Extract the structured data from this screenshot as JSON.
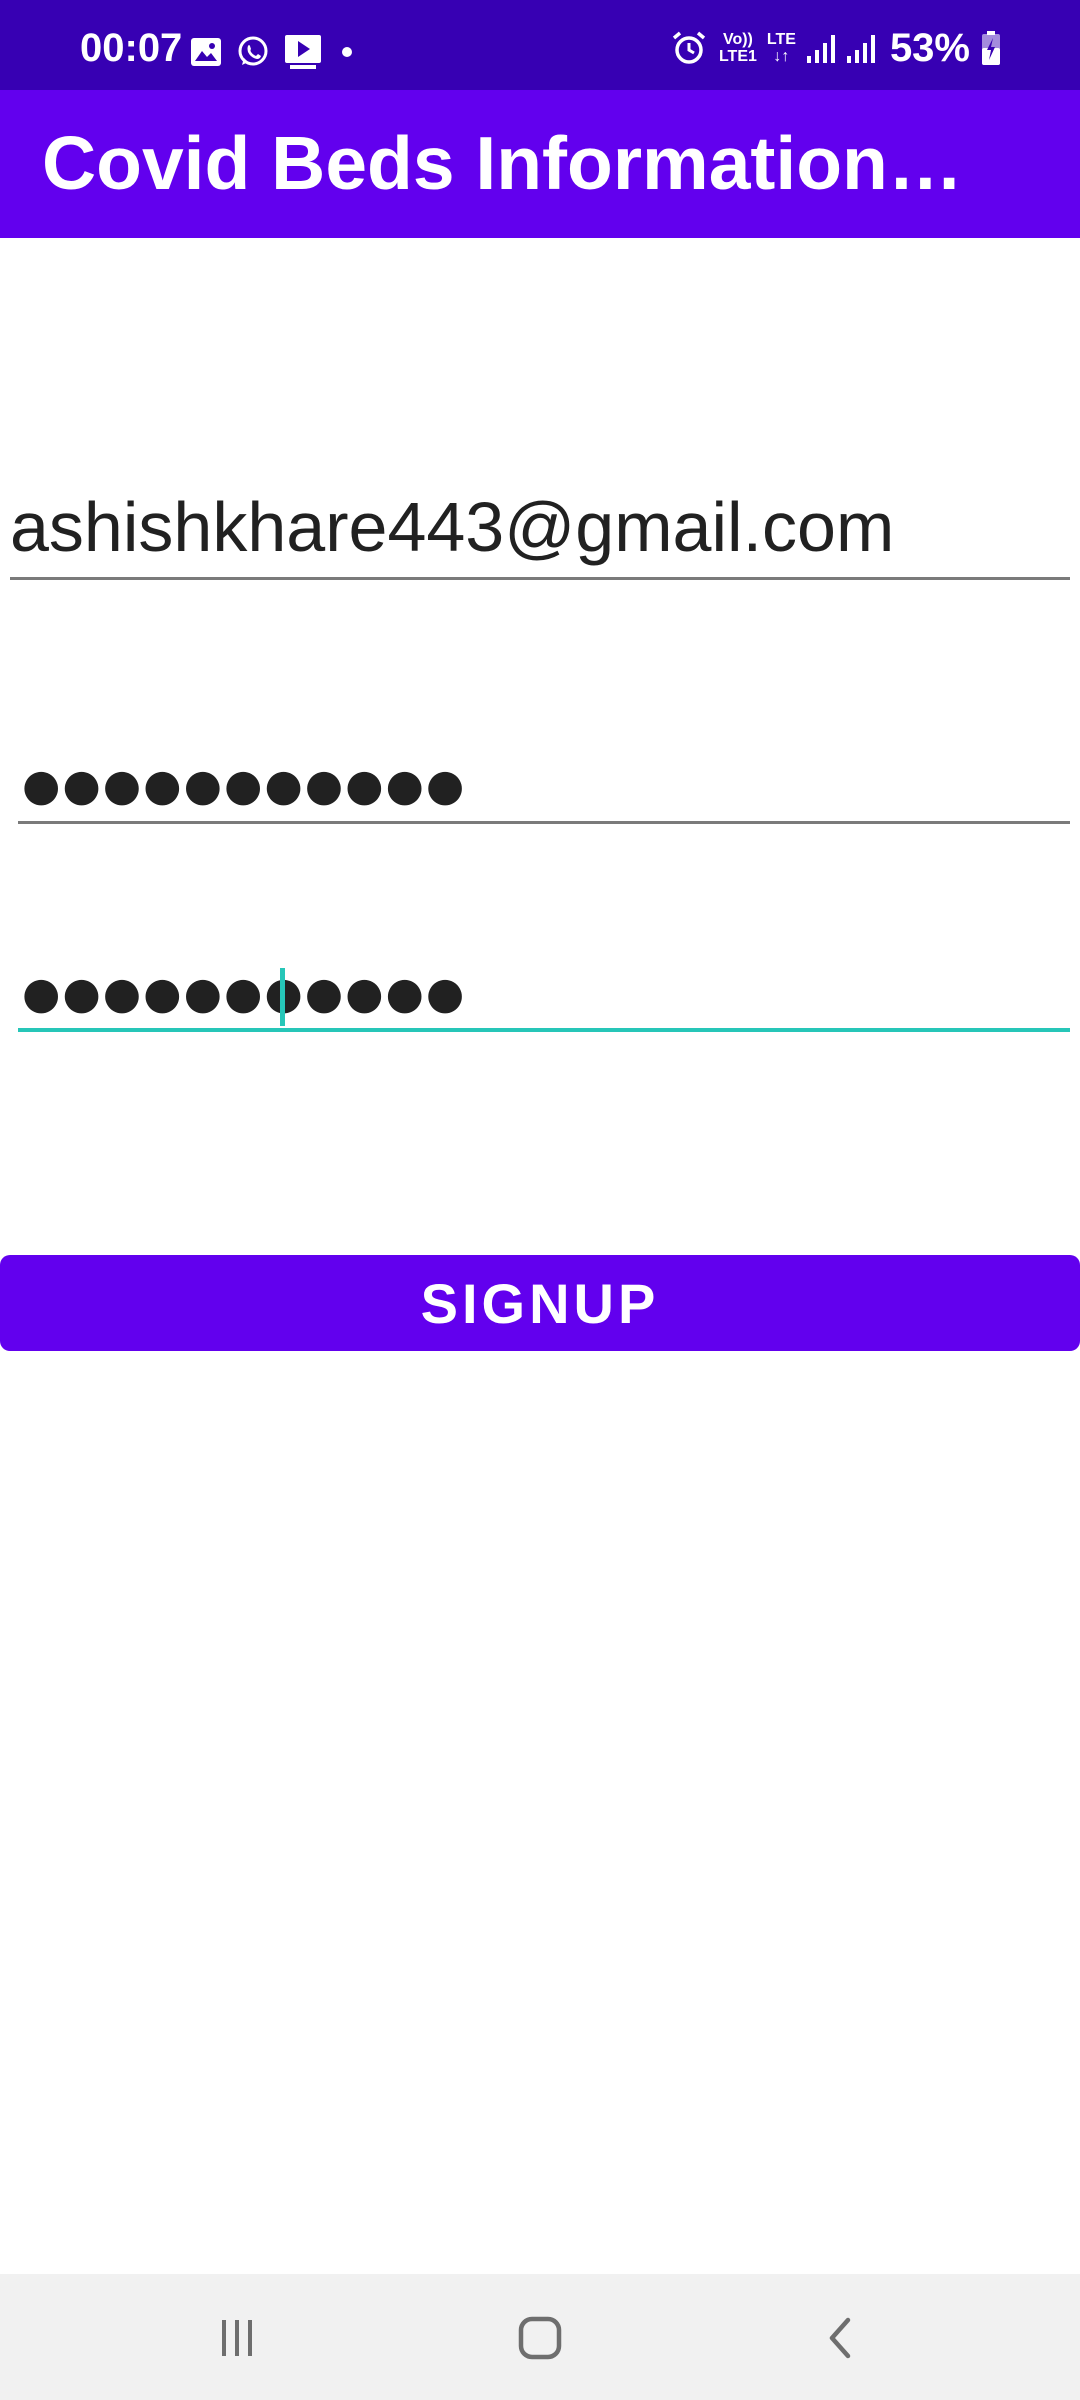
{
  "status_bar": {
    "time": "00:07",
    "left_icons": [
      "gallery-icon",
      "whatsapp-icon",
      "media-icon",
      "notification-dot-icon"
    ],
    "right_icons": [
      "alarm-icon",
      "volte-icon",
      "lte-icon",
      "signal-icon",
      "signal-icon",
      "battery-charging-icon"
    ],
    "volte_label_top": "Vo))",
    "volte_label_bottom": "LTE1",
    "lte_label": "LTE",
    "battery": "53%"
  },
  "app_bar": {
    "title": "Covid Beds Information…"
  },
  "form": {
    "email_value": "ashishkhare443@gmail.com",
    "password_mask": "●●●●●●●●●●●",
    "confirm_password_mask": "●●●●●●●●●●●",
    "signup_label": "SIGNUP"
  },
  "nav_bar": {
    "buttons": [
      "recent-apps-icon",
      "home-icon",
      "back-icon"
    ]
  },
  "colors": {
    "status_bar": "#3700b3",
    "primary": "#6200ee",
    "accent": "#26c6b8",
    "nav_bar": "#f1f1f1"
  }
}
